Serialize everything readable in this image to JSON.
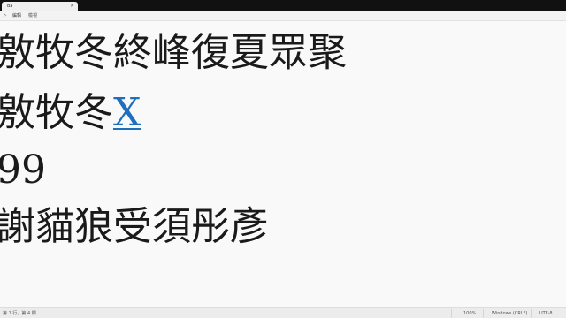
{
  "window": {
    "tab_title": "Ba",
    "tab_close_glyph": "×"
  },
  "menubar": {
    "items": [
      "ト",
      "編輯",
      "檢視"
    ]
  },
  "editor": {
    "lines": [
      {
        "text": "敫牧冬終峰復夏眾聚"
      },
      {
        "text": "敫牧冬",
        "link_text": "X"
      },
      {
        "text": "99"
      },
      {
        "text": "謝貓狼受須彤彥"
      }
    ]
  },
  "statusbar": {
    "position": "第 1 行，第 4 欄",
    "zoom": "100%",
    "line_ending": "Windows (CRLF)",
    "encoding": "UTF-8"
  },
  "colors": {
    "link": "#1f6fbf",
    "titlebar": "#111111",
    "editor_bg": "#f9f9f9"
  }
}
